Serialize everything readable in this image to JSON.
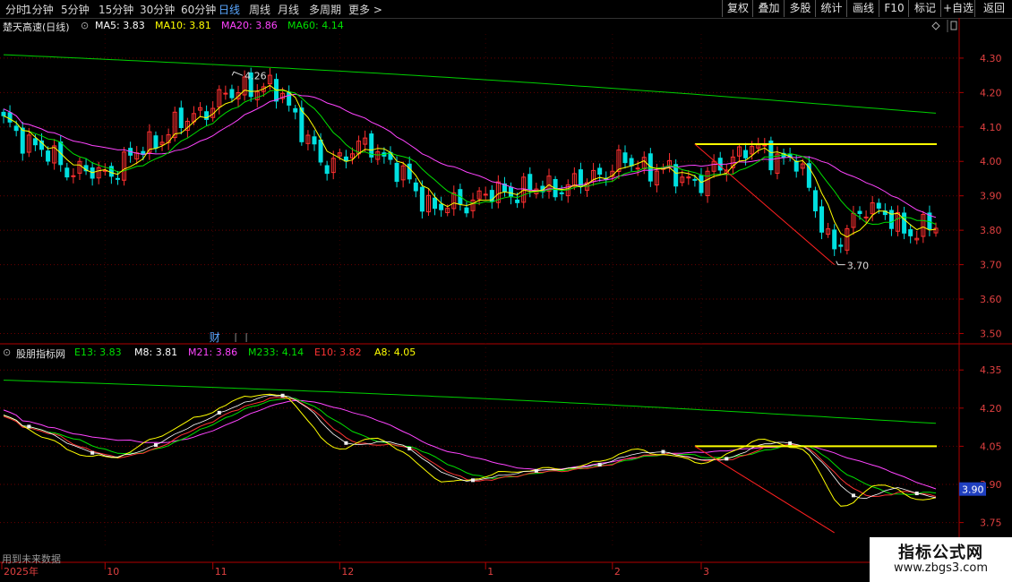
{
  "toolbar": {
    "tabs": [
      "分时",
      "1分钟",
      "5分钟",
      "15分钟",
      "30分钟",
      "60分钟",
      "日线",
      "周线",
      "月线",
      "多周期",
      "更多"
    ],
    "active_tab": "日线",
    "right_buttons": [
      "复权",
      "叠加",
      "多股",
      "统计",
      "画线",
      "F10",
      "标记",
      "+自选",
      "返回"
    ]
  },
  "header": {
    "stock_name": "楚天高速(日线)",
    "ma_labels": [
      {
        "text": "MA5: 3.83",
        "color": "#ffffff"
      },
      {
        "text": "MA10: 3.81",
        "color": "#ffff00"
      },
      {
        "text": "MA20: 3.86",
        "color": "#ff44ff"
      },
      {
        "text": "MA60: 4.14",
        "color": "#00e000"
      }
    ]
  },
  "sub_header": {
    "indicator_name": "股朋指标网",
    "labels": [
      {
        "text": "E13: 3.83",
        "color": "#00e000"
      },
      {
        "text": "M8: 3.81",
        "color": "#ffffff"
      },
      {
        "text": "M21: 3.86",
        "color": "#ff44ff"
      },
      {
        "text": "M233: 4.14",
        "color": "#00e000"
      },
      {
        "text": "E10: 3.82",
        "color": "#ff3333"
      },
      {
        "text": "A8: 4.05",
        "color": "#ffff00"
      }
    ]
  },
  "annotations": {
    "high": "4.26",
    "low": "3.70",
    "finance_marker": "财",
    "footer_note": "用到未来数据",
    "price_flag": "3.90"
  },
  "watermark": {
    "line1": "指标公式网",
    "line2": "www.zbgs3.com"
  },
  "chart_data": [
    {
      "type": "candlestick",
      "title": "楚天高速(日线)",
      "y_ticks": [
        "4.30",
        "4.20",
        "4.10",
        "4.00",
        "3.90",
        "3.80",
        "3.70",
        "3.60",
        "3.50"
      ],
      "ylim": [
        3.47,
        4.37
      ],
      "x_ticks": [
        "2025年",
        "10",
        "11",
        "12",
        "1",
        "2",
        "3"
      ],
      "n_bars": 148,
      "key_points": [
        {
          "bar": 0,
          "close": 4.11
        },
        {
          "bar": 10,
          "close": 3.98
        },
        {
          "bar": 16,
          "close": 3.96
        },
        {
          "bar": 27,
          "close": 4.1
        },
        {
          "bar": 38,
          "close": 4.22
        },
        {
          "bar": 44,
          "close": 4.2
        },
        {
          "bar": 50,
          "close": 3.99
        },
        {
          "bar": 58,
          "close": 4.05
        },
        {
          "bar": 68,
          "close": 3.86
        },
        {
          "bar": 78,
          "close": 3.91
        },
        {
          "bar": 90,
          "close": 3.93
        },
        {
          "bar": 98,
          "close": 4.0
        },
        {
          "bar": 110,
          "close": 3.94
        },
        {
          "bar": 117,
          "close": 4.04
        },
        {
          "bar": 125,
          "close": 4.0
        },
        {
          "bar": 131,
          "close": 3.74
        },
        {
          "bar": 136,
          "close": 3.88
        },
        {
          "bar": 142,
          "close": 3.8
        },
        {
          "bar": 147,
          "close": 3.81
        }
      ],
      "ma_last": {
        "MA5": 3.83,
        "MA10": 3.81,
        "MA20": 3.86,
        "MA60": 4.14
      },
      "ma60_start": 4.31,
      "hline_value": 4.05,
      "grid": true
    },
    {
      "type": "line",
      "title": "股朋指标网",
      "y_ticks": [
        "4.35",
        "4.20",
        "4.05",
        "3.90",
        "3.75"
      ],
      "ylim": [
        3.65,
        4.4
      ],
      "hline_value": 4.05,
      "last": {
        "E13": 3.83,
        "M8": 3.81,
        "M21": 3.86,
        "M233": 4.14,
        "E10": 3.82,
        "A8": 4.05
      }
    }
  ]
}
